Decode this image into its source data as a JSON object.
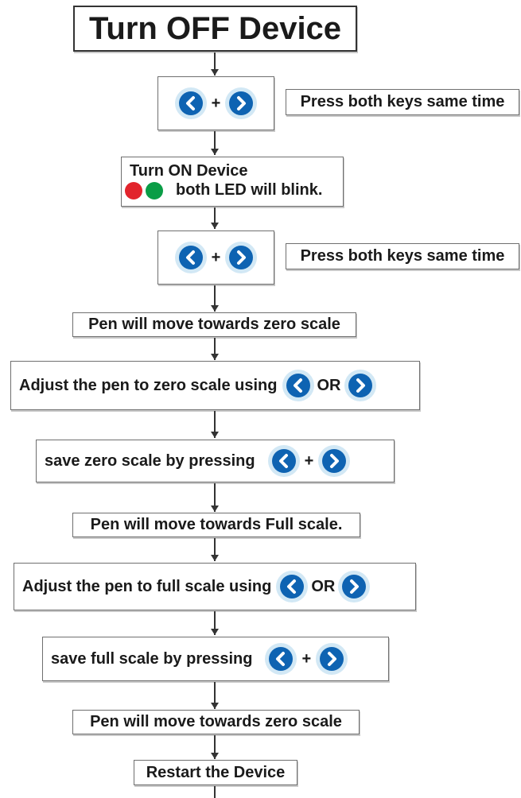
{
  "title": "Turn OFF Device",
  "keys_note_1": "Press both keys same time",
  "turn_on_title": "Turn ON Device",
  "led_note": "both LED will blink.",
  "keys_note_2": "Press both keys same time",
  "pen_zero_1": "Pen will move towards zero scale",
  "adjust_zero": "Adjust the pen to zero scale using",
  "or_1": "OR",
  "save_zero": "save zero scale by pressing",
  "plus": "+",
  "pen_full": "Pen will move towards Full scale.",
  "adjust_full": "Adjust the pen to full scale using",
  "or_2": "OR",
  "save_full": "save full scale by pressing",
  "pen_zero_2": "Pen will move towards zero scale",
  "restart": "Restart the Device",
  "colors": {
    "key_blue": "#0e63b2",
    "key_halo": "#d2e8f5",
    "led_red": "#e2242c",
    "led_green": "#0a9d46"
  },
  "icons": [
    "left-arrow-key-icon",
    "right-arrow-key-icon",
    "red-led-icon",
    "green-led-icon"
  ]
}
